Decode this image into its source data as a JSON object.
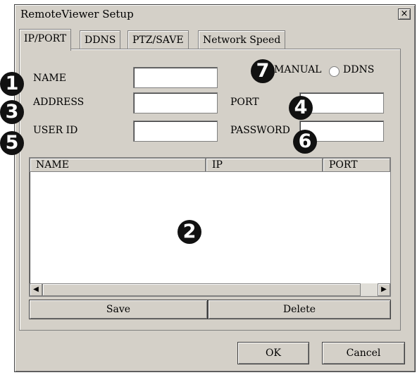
{
  "window": {
    "title": "RemoteViewer Setup",
    "close_glyph": "×"
  },
  "tabs": [
    {
      "label": "IP/PORT",
      "active": true
    },
    {
      "label": "DDNS",
      "active": false
    },
    {
      "label": "PTZ/SAVE",
      "active": false
    },
    {
      "label": "Network Speed",
      "active": false
    }
  ],
  "form": {
    "name_label": "NAME",
    "address_label": "ADDRESS",
    "user_id_label": "USER ID",
    "port_label": "PORT",
    "password_label": "PASSWORD",
    "manual_label": "MANUAL",
    "ddns_label": "DDNS",
    "name_value": "",
    "address_value": "",
    "user_id_value": "",
    "port_value": "",
    "password_value": ""
  },
  "list": {
    "columns": [
      "NAME",
      "IP",
      "PORT"
    ],
    "rows": []
  },
  "buttons": {
    "save": "Save",
    "delete": "Delete",
    "ok": "OK",
    "cancel": "Cancel"
  },
  "scroll": {
    "left_glyph": "◀",
    "right_glyph": "▶"
  },
  "callouts": [
    "1",
    "2",
    "3",
    "4",
    "5",
    "6",
    "7"
  ],
  "colors": {
    "dialog_face": "#d4d0c8",
    "callout_fill": "#111111"
  }
}
